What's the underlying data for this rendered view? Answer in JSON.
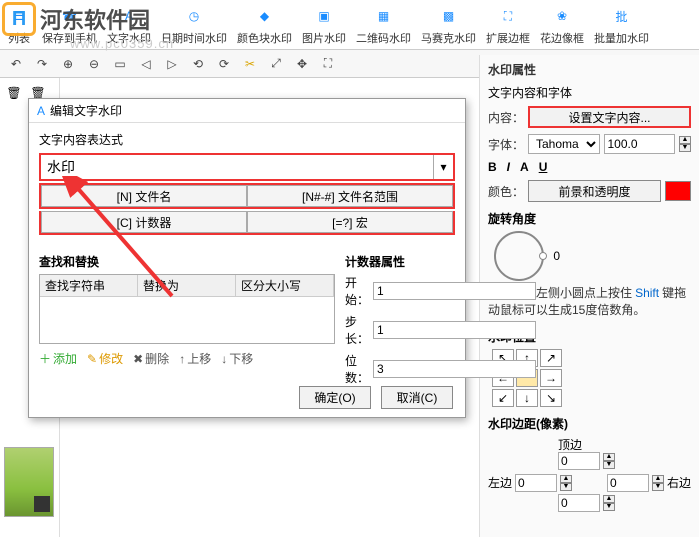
{
  "site_watermark": {
    "logo_text": "河东软件园",
    "url": "www.pc0359.cn"
  },
  "toolbar": {
    "items": [
      {
        "id": "list",
        "label": "列表"
      },
      {
        "id": "save-phone",
        "label": "保存到手机"
      },
      {
        "id": "text-wm",
        "label": "文字水印"
      },
      {
        "id": "datetime-wm",
        "label": "日期时间水印"
      },
      {
        "id": "colorblock-wm",
        "label": "颜色块水印"
      },
      {
        "id": "image-wm",
        "label": "图片水印"
      },
      {
        "id": "qrcode-wm",
        "label": "二维码水印"
      },
      {
        "id": "mosaic-wm",
        "label": "马赛克水印"
      },
      {
        "id": "extend-border",
        "label": "扩展边框"
      },
      {
        "id": "lace-frame",
        "label": "花边像框"
      },
      {
        "id": "batch-wm",
        "label": "批量加水印"
      }
    ]
  },
  "right": {
    "title": "水印属性",
    "font_section": "文字内容和字体",
    "content_label": "内容：",
    "content_button": "设置文字内容...",
    "font_label": "字体：",
    "font_value": "Tahoma",
    "size_value": "100.0",
    "style_buttons": [
      "B",
      "I",
      "A",
      "U"
    ],
    "color_label": "颜色：",
    "color_button": "前景和透明度",
    "rotate_title": "旋转角度",
    "rotate_value": "0",
    "help_text_1": "说明：在左侧小圆点上按住",
    "help_text_kw": "Shift",
    "help_text_2": "键拖动鼠标可以生成15度倍数角。",
    "position_title": "水印位置",
    "margin_title": "水印边距(像素)",
    "margin": {
      "top_label": "顶边",
      "left_label": "左边",
      "right_label": "右边",
      "top": "0",
      "left": "0",
      "right": "0",
      "bottom": "0"
    }
  },
  "dialog": {
    "title": "编辑文字水印",
    "expr_label": "文字内容表达式",
    "expr_value": "水印",
    "quick": [
      {
        "label": "[N] 文件名"
      },
      {
        "label": "[N#-#] 文件名范围"
      },
      {
        "label": "[C] 计数器"
      },
      {
        "label": "[=?] 宏"
      }
    ],
    "find": {
      "title": "查找和替换",
      "cols": [
        "查找字符串",
        "替换为",
        "区分大小写"
      ],
      "actions": {
        "add": "添加",
        "edit": "修改",
        "delete": "删除",
        "up": "上移",
        "down": "下移"
      }
    },
    "counter": {
      "title": "计数器属性",
      "start_label": "开始：",
      "start": "1",
      "step_label": "步长：",
      "step": "1",
      "digits_label": "位数：",
      "digits": "3"
    },
    "ok": "确定(O)",
    "cancel": "取消(C)"
  }
}
